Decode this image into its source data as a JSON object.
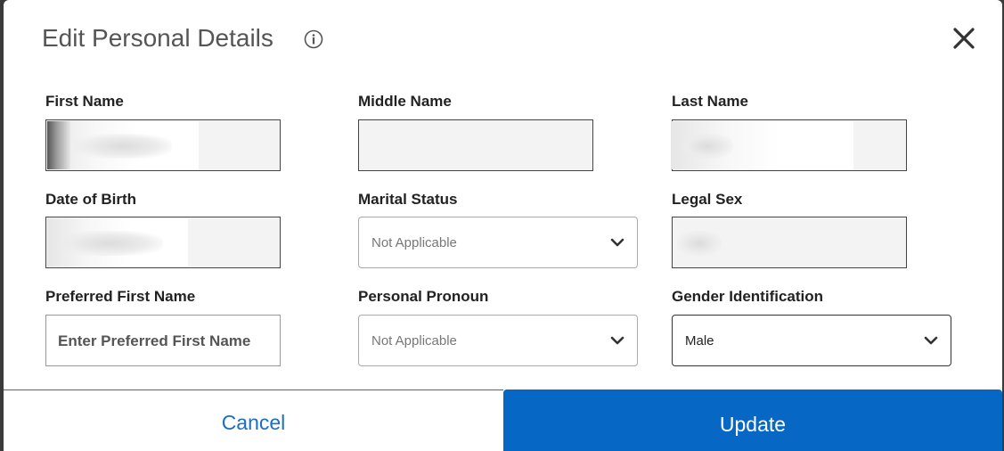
{
  "dialog": {
    "title": "Edit Personal Details",
    "info_icon": "info-icon",
    "close_icon": "close-icon"
  },
  "fields": {
    "first_name": {
      "label": "First Name"
    },
    "middle_name": {
      "label": "Middle Name"
    },
    "last_name": {
      "label": "Last Name"
    },
    "date_of_birth": {
      "label": "Date of Birth"
    },
    "marital_status": {
      "label": "Marital Status",
      "value": "Not Applicable"
    },
    "legal_sex": {
      "label": "Legal Sex"
    },
    "preferred_first_name": {
      "label": "Preferred First Name",
      "placeholder": "Enter Preferred First Name"
    },
    "personal_pronoun": {
      "label": "Personal Pronoun",
      "value": "Not Applicable"
    },
    "gender_identification": {
      "label": "Gender Identification",
      "value": "Male"
    }
  },
  "actions": {
    "cancel_label": "Cancel",
    "update_label": "Update"
  },
  "colors": {
    "primary": "#0667c4",
    "link": "#1a6fc0"
  }
}
